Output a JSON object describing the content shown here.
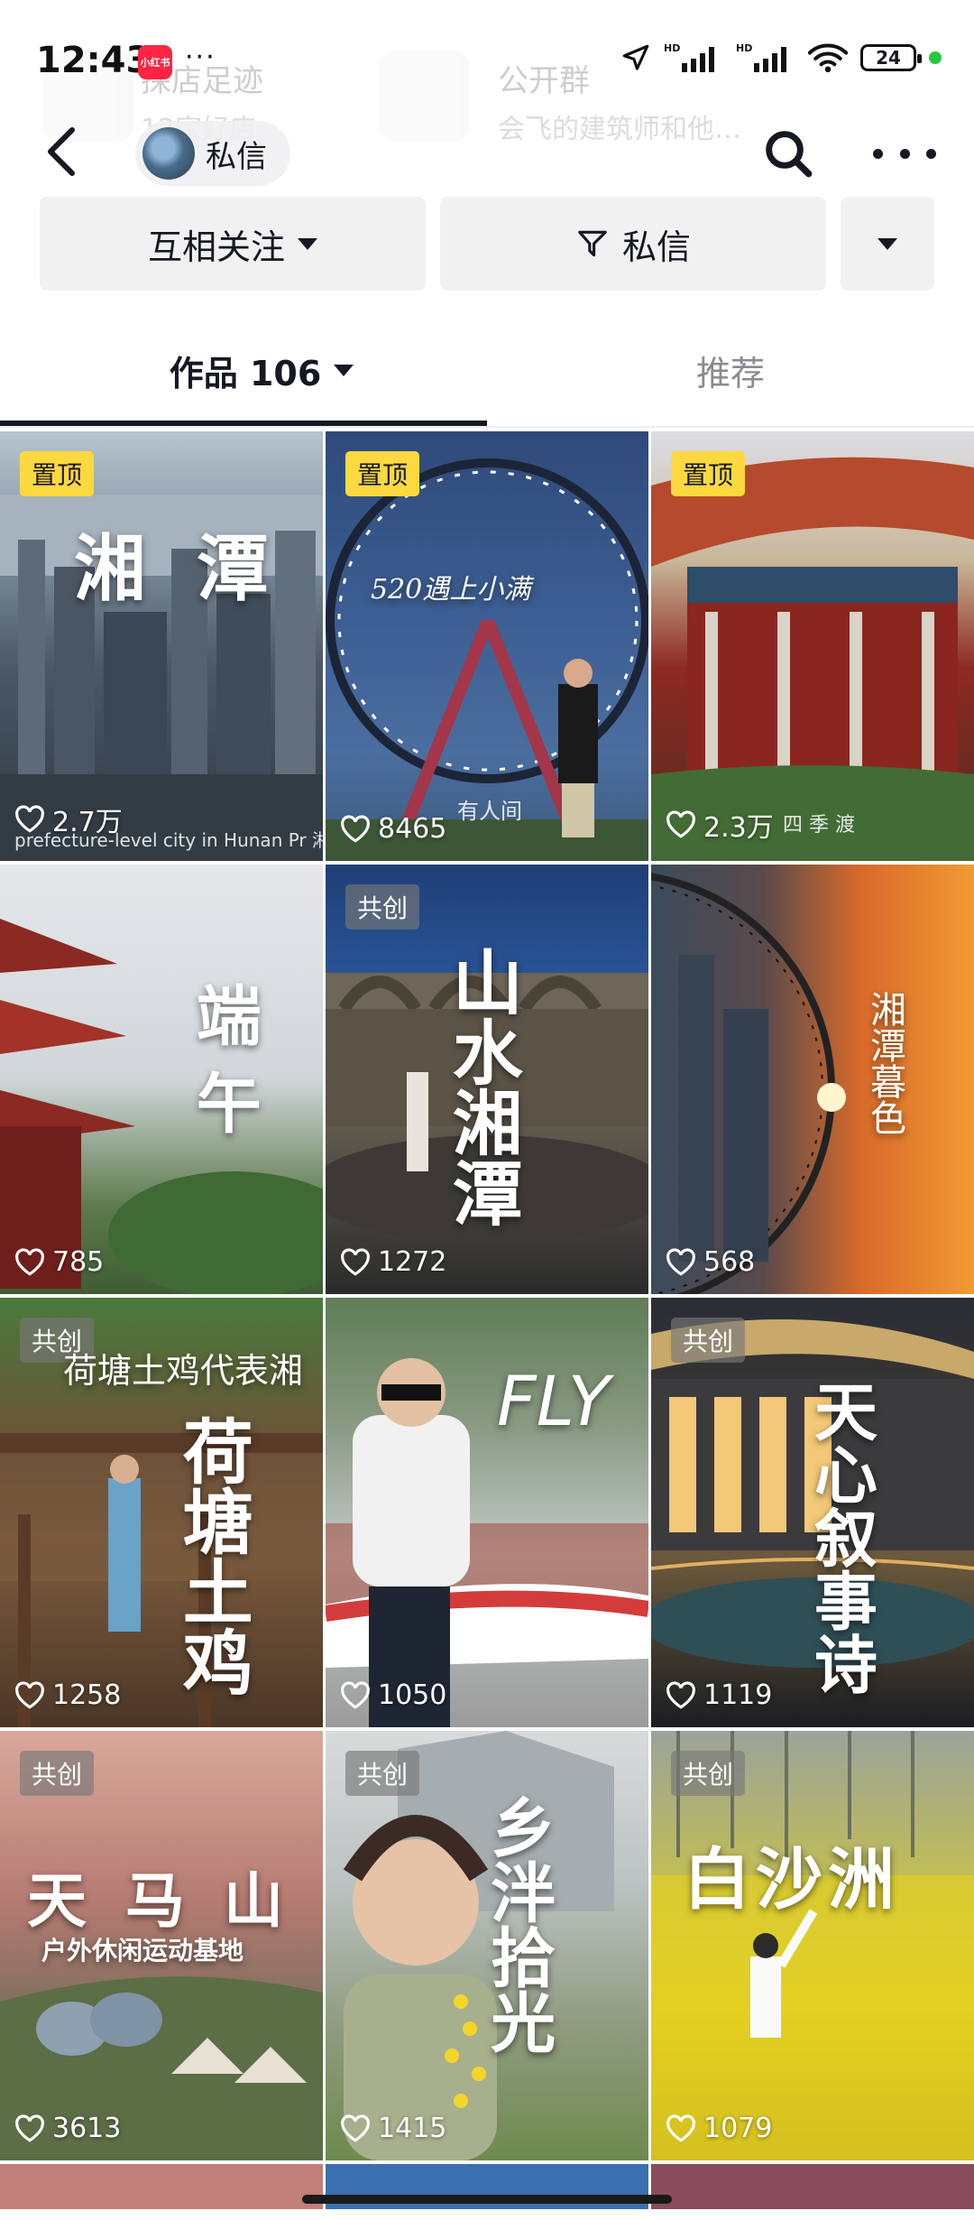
{
  "status": {
    "time": "12:43",
    "app_badge": "小红书",
    "battery": "24",
    "net1": "HD",
    "net2": "HD"
  },
  "ghost": {
    "item1_title": "探店足迹",
    "item1_sub": "12家好店",
    "item2_title": "公开群",
    "item2_sub": "会飞的建筑师和他…"
  },
  "header": {
    "dm_label": "私信"
  },
  "actions": {
    "follow_label": "互相关注",
    "message_label": "私信"
  },
  "tabs": [
    {
      "label": "作品 106"
    },
    {
      "label": "推荐"
    }
  ],
  "badges": {
    "pinned": "置顶",
    "cocreate": "共创"
  },
  "tiles": [
    {
      "title": "湘 潭",
      "caption": "prefecture-level city in Hunan Pr   湘 · 中国湖南省地级市",
      "likes": "2.7万",
      "badge": "置顶"
    },
    {
      "title": "520遇上小满",
      "caption": "有人间",
      "likes": "8465",
      "badge": "置顶"
    },
    {
      "title": "",
      "caption": "四 季 渡",
      "likes": "2.3万",
      "badge": "置顶"
    },
    {
      "title": "端 午",
      "caption": "",
      "likes": "785",
      "badge": ""
    },
    {
      "title": "山水湘潭",
      "caption": "",
      "likes": "1272",
      "badge": "共创"
    },
    {
      "title": "湘潭暮色",
      "caption": "",
      "likes": "568",
      "badge": ""
    },
    {
      "title": "荷塘土鸡",
      "subtitle": "荷塘土鸡代表湘",
      "caption": "",
      "likes": "1258",
      "badge": "共创"
    },
    {
      "title": "FLY",
      "caption": "",
      "likes": "1050",
      "badge": ""
    },
    {
      "title": "天心叙事诗",
      "caption": "",
      "likes": "1119",
      "badge": "共创"
    },
    {
      "title": "天 马 山",
      "subtitle": "户外休闲运动基地",
      "caption": "",
      "likes": "3613",
      "badge": "共创"
    },
    {
      "title": "乡泮拾光",
      "caption": "",
      "likes": "1415",
      "badge": "共创"
    },
    {
      "title": "白沙洲",
      "caption": "",
      "likes": "1079",
      "badge": "共创"
    }
  ],
  "colors": {
    "pin_badge": "#fdd93f",
    "brand_red": "#ff2442",
    "text_primary": "#161823",
    "text_secondary": "#8a8b91"
  }
}
